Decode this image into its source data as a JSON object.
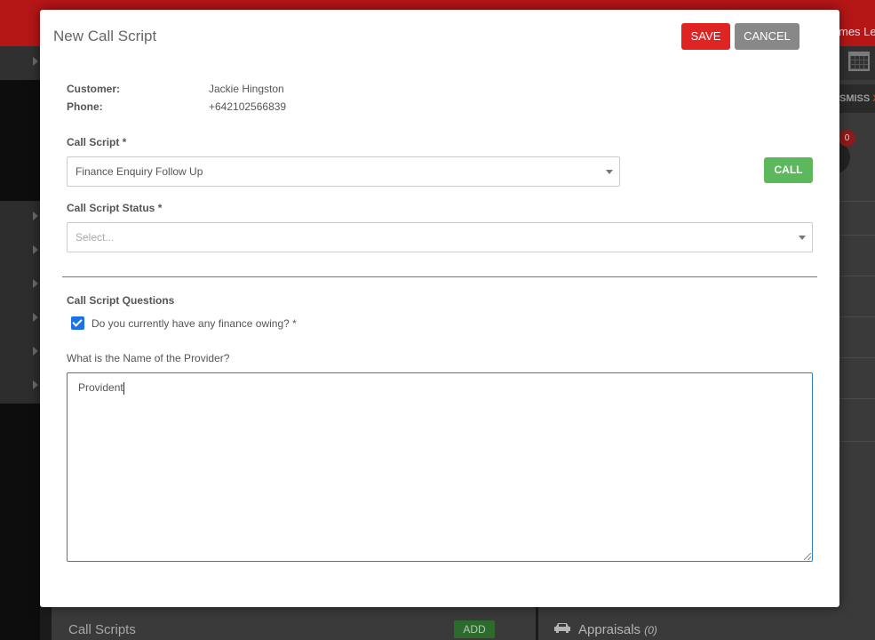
{
  "background": {
    "user_name_fragment": "mes Le",
    "dismiss_label": "SMISS",
    "dismiss_x": "X",
    "badge_count": "0",
    "call_scripts_title": "Call Scripts",
    "add_label": "ADD",
    "appraisals_label": "Appraisals",
    "appraisals_count": "(0)"
  },
  "modal": {
    "title": "New Call Script",
    "save_label": "SAVE",
    "cancel_label": "CANCEL",
    "customer_label": "Customer:",
    "customer_value": "Jackie Hingston",
    "phone_label": "Phone:",
    "phone_value": "+642102566839",
    "call_script_label": "Call Script *",
    "call_script_value": "Finance Enquiry Follow Up",
    "call_label": "CALL",
    "status_label": "Call Script Status *",
    "status_placeholder": "Select...",
    "questions_title": "Call Script Questions",
    "finance_question": "Do you currently have any finance owing? *",
    "finance_checked": true,
    "provider_question": "What is the Name of the Provider?",
    "provider_answer": "Provident"
  },
  "colors": {
    "save": "#e02424",
    "cancel": "#888888",
    "call": "#5cb85c",
    "checkbox": "#1a73e8",
    "topbar": "#b51616"
  }
}
